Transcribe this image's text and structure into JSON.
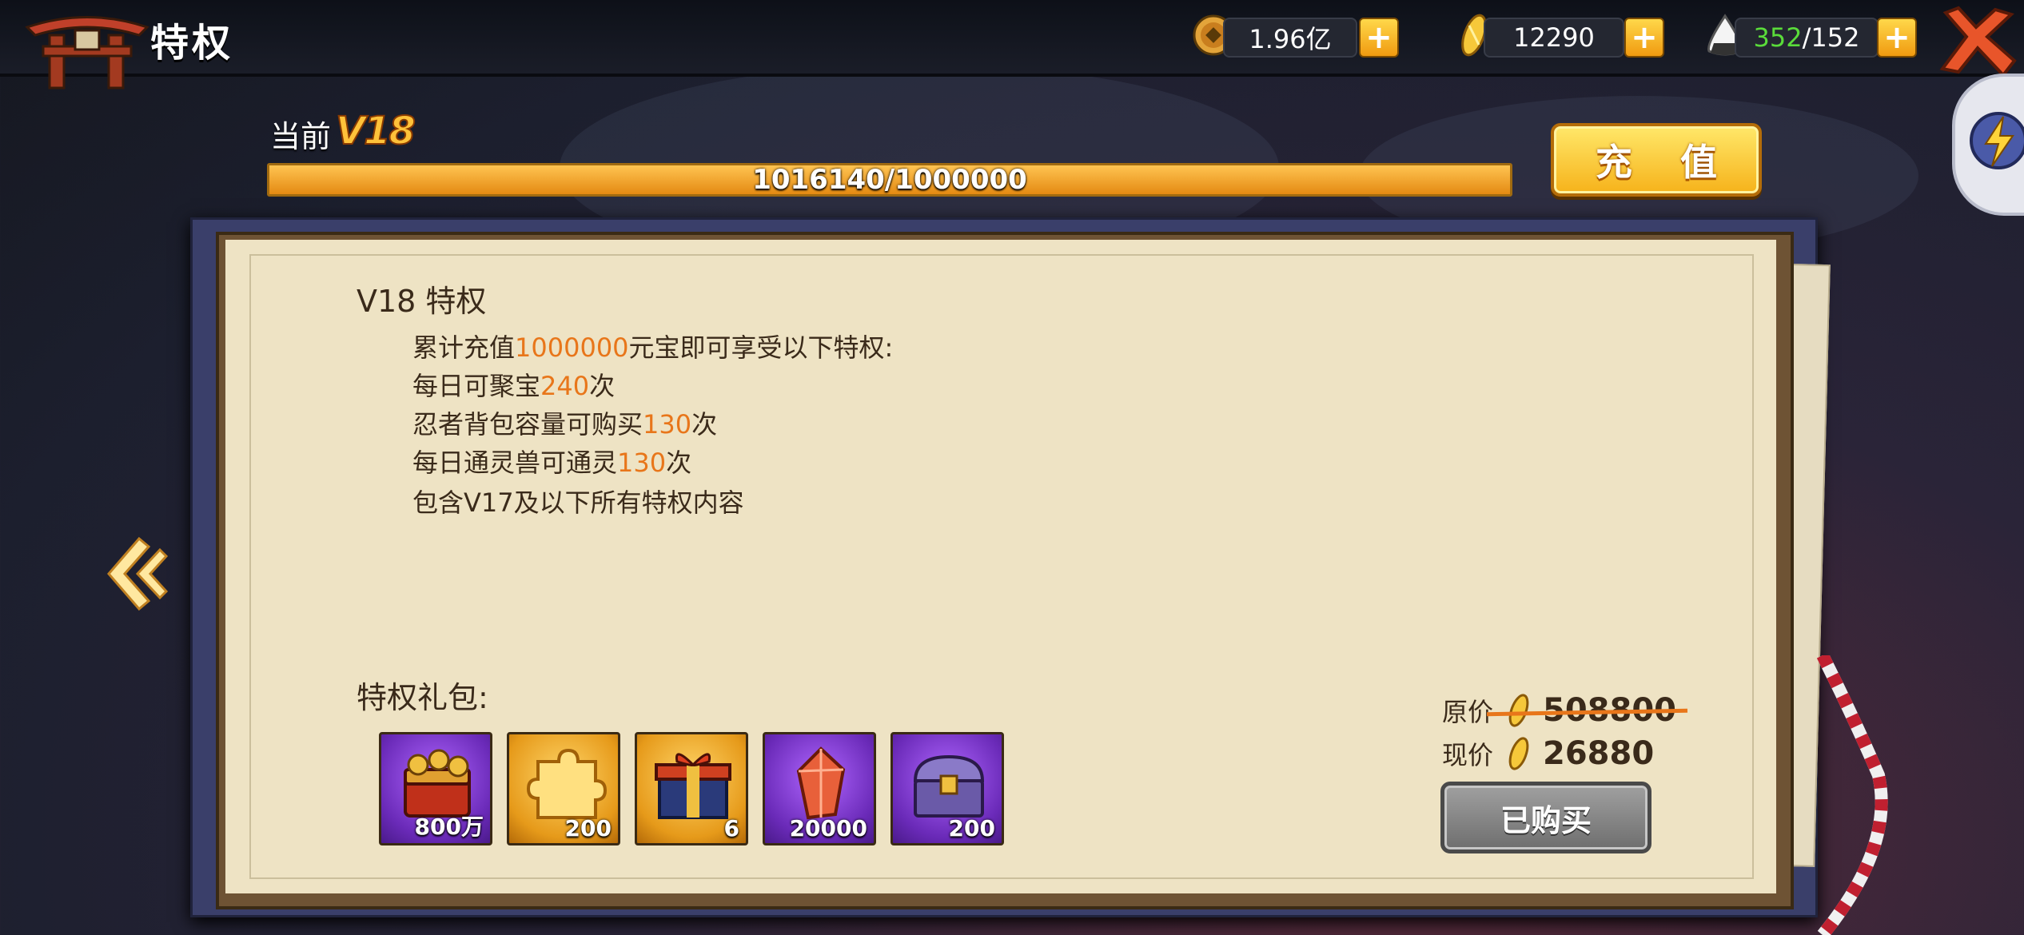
{
  "header": {
    "title": "特权"
  },
  "resources": [
    {
      "icon": "coin-icon",
      "value": "1.96亿"
    },
    {
      "icon": "gold-ingot-icon",
      "value": "12290"
    },
    {
      "icon": "rice-ball-icon",
      "value_current": "352",
      "value_max": "/152"
    }
  ],
  "vip": {
    "current_label": "当前",
    "level": "V18",
    "progress_text": "1016140/1000000",
    "progress_fraction": 1.0,
    "recharge_label": "充 值"
  },
  "privilege": {
    "title": "V18  特权",
    "lines": [
      {
        "pre": "累计充值",
        "hl": "1000000",
        "post": "元宝即可享受以下特权:"
      },
      {
        "pre": "每日可聚宝",
        "hl": "240",
        "post": "次"
      },
      {
        "pre": "忍者背包容量可购买",
        "hl": "130",
        "post": "次"
      },
      {
        "pre": "每日通灵兽可通灵",
        "hl": "130",
        "post": "次"
      },
      {
        "pre": "包含V17及以下所有特权内容",
        "hl": "",
        "post": ""
      }
    ]
  },
  "gift": {
    "title": "特权礼包:",
    "items": [
      {
        "name": "coin-chest-icon",
        "qty": "800万",
        "frame": "purple"
      },
      {
        "name": "puzzle-piece-icon",
        "qty": "200",
        "frame": "gold"
      },
      {
        "name": "gift-box-icon",
        "qty": "6",
        "frame": "gold"
      },
      {
        "name": "red-crystal-icon",
        "qty": "20000",
        "frame": "purple"
      },
      {
        "name": "treasure-chest-icon",
        "qty": "200",
        "frame": "purple"
      }
    ],
    "original_price_label": "原价",
    "original_price": "508800",
    "current_price_label": "现价",
    "current_price": "26880",
    "bought_label": "已购买"
  },
  "colors": {
    "highlight": "#e8761a",
    "progress_fill": "#f0a030",
    "paper": "#eee3c4"
  }
}
